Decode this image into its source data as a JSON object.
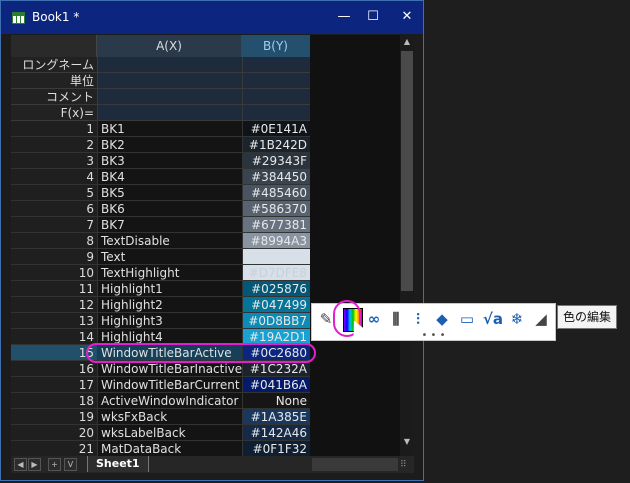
{
  "window": {
    "title": "Book1 *",
    "minimize_glyph": "—",
    "maximize_glyph": "☐",
    "close_glyph": "✕",
    "title_bar_color": "#0C2680"
  },
  "sheet": {
    "col_a_header": "A(X)",
    "col_b_header": "B(Y)",
    "meta_rows": [
      "ロングネーム",
      "単位",
      "コメント",
      "F(x)="
    ],
    "rows": [
      {
        "n": "1",
        "name": "BK1",
        "value": "#0E141A",
        "color": "#0E141A"
      },
      {
        "n": "2",
        "name": "BK2",
        "value": "#1B242D",
        "color": "#1B242D"
      },
      {
        "n": "3",
        "name": "BK3",
        "value": "#29343F",
        "color": "#29343F"
      },
      {
        "n": "4",
        "name": "BK4",
        "value": "#384450",
        "color": "#384450"
      },
      {
        "n": "5",
        "name": "BK5",
        "value": "#485460",
        "color": "#485460"
      },
      {
        "n": "6",
        "name": "BK6",
        "value": "#586370",
        "color": "#586370"
      },
      {
        "n": "7",
        "name": "BK7",
        "value": "#677381",
        "color": "#677381"
      },
      {
        "n": "8",
        "name": "TextDisable",
        "value": "#8994A3",
        "color": "#8994A3"
      },
      {
        "n": "9",
        "name": "Text",
        "value": "",
        "color": "#D7DFE8"
      },
      {
        "n": "10",
        "name": "TextHighlight",
        "value": "#D7DFE8",
        "color": "#D7DFE8"
      },
      {
        "n": "11",
        "name": "Highlight1",
        "value": "#025876",
        "color": "#025876"
      },
      {
        "n": "12",
        "name": "Highlight2",
        "value": "#047499",
        "color": "#047499"
      },
      {
        "n": "13",
        "name": "Highlight3",
        "value": "#0D8BB7",
        "color": "#0D8BB7"
      },
      {
        "n": "14",
        "name": "Highlight4",
        "value": "#19A2D1",
        "color": "#19A2D1"
      },
      {
        "n": "15",
        "name": "WindowTitleBarActive",
        "value": "#0C2680",
        "color": "#0C2680"
      },
      {
        "n": "16",
        "name": "WindowTitleBarInactive",
        "value": "#1C232A",
        "color": "#1C232A"
      },
      {
        "n": "17",
        "name": "WindowTitleBarCurrent",
        "value": "#041B6A",
        "color": "#041B6A"
      },
      {
        "n": "18",
        "name": "ActiveWindowIndicator",
        "value": "None",
        "color": "#161616"
      },
      {
        "n": "19",
        "name": "wksFxBack",
        "value": "#1A385E",
        "color": "#1A385E"
      },
      {
        "n": "20",
        "name": "wksLabelBack",
        "value": "#142A46",
        "color": "#142A46"
      },
      {
        "n": "21",
        "name": "MatDataBack",
        "value": "#0F1F32",
        "color": "#0F1F32"
      }
    ]
  },
  "tabs": {
    "sheet_label": "Sheet1",
    "add_label": "+",
    "list_label": "V",
    "prev_label": "◀",
    "next_label": "▶"
  },
  "toolbar": {
    "more_label": "• • •",
    "tooltip": "色の編集",
    "icons": [
      "pen-icon",
      "color-edit-icon",
      "link-icon",
      "column-icon",
      "chart-data-icon",
      "tag-icon",
      "comment-icon",
      "formula-icon",
      "freeze-icon",
      "fill-icon"
    ]
  }
}
